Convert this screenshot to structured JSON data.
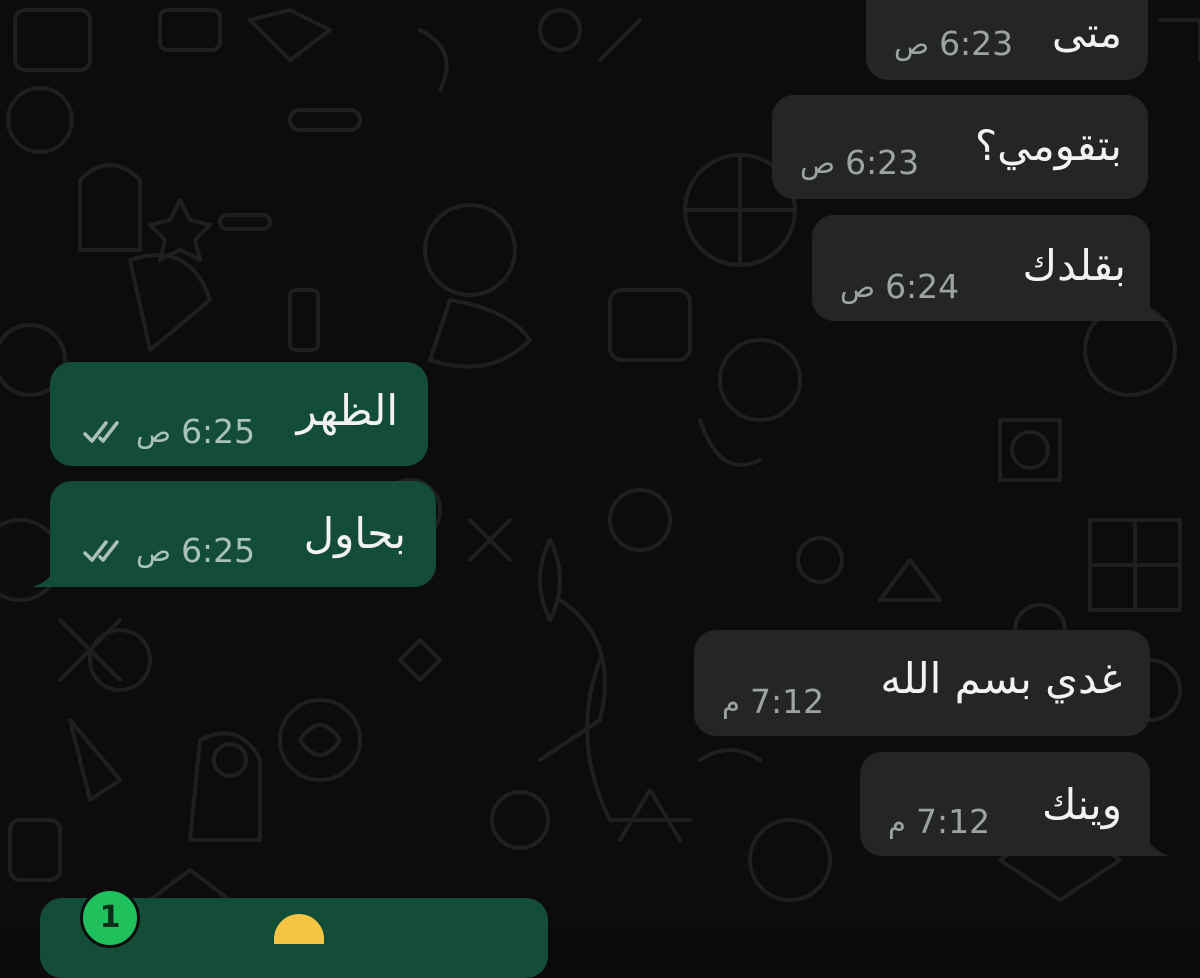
{
  "chat": {
    "messages": [
      {
        "id": "m1",
        "direction": "incoming",
        "text": "متى",
        "time": "6:23",
        "ampm": "ص"
      },
      {
        "id": "m2",
        "direction": "incoming",
        "text": "بتقومي؟",
        "time": "6:23",
        "ampm": "ص"
      },
      {
        "id": "m3",
        "direction": "incoming",
        "text": "بقلدك",
        "time": "6:24",
        "ampm": "ص"
      },
      {
        "id": "m4",
        "direction": "outgoing",
        "text": "الظهر",
        "time": "6:25",
        "ampm": "ص",
        "status_icon": "double-check-icon"
      },
      {
        "id": "m5",
        "direction": "outgoing",
        "text": "بحاول",
        "time": "6:25",
        "ampm": "ص",
        "status_icon": "double-check-icon"
      },
      {
        "id": "m6",
        "direction": "incoming",
        "text": "غدي بسم الله",
        "time": "7:12",
        "ampm": "م"
      },
      {
        "id": "m7",
        "direction": "incoming",
        "text": "وينك",
        "time": "7:12",
        "ampm": "م"
      }
    ],
    "unread_badge": "1",
    "colors": {
      "background": "#0c0c0c",
      "incoming_bubble": "#242626",
      "outgoing_bubble": "#144d37",
      "badge": "#20c05c"
    }
  }
}
